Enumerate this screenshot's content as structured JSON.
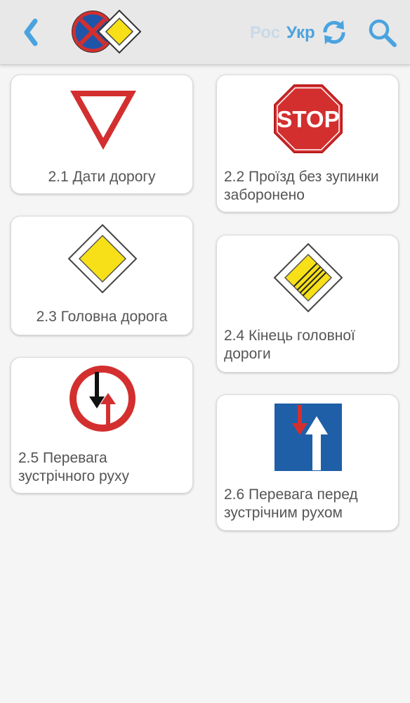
{
  "header": {
    "back_icon": "chevron-left-icon",
    "logo_icon": "road-signs-logo-icon",
    "lang_ru": "Рос",
    "lang_uk": "Укр",
    "swap_icon": "refresh-icon",
    "search_icon": "search-icon",
    "colors": {
      "accent": "#4aa3df",
      "inactive": "#c9d9e8",
      "bar": "#e8e8e8"
    }
  },
  "signs": [
    {
      "label": "2.1 Дати дорогу",
      "icon": "give-way-sign-icon"
    },
    {
      "label": "2.2 Проїзд без зупинки заборонено",
      "icon": "stop-sign-icon",
      "sign_text": "STOP"
    },
    {
      "label": "2.3 Головна дорога",
      "icon": "priority-road-sign-icon"
    },
    {
      "label": "2.4 Кінець головної дороги",
      "icon": "end-priority-road-sign-icon"
    },
    {
      "label": "2.5 Перевага зустрічного руху",
      "icon": "oncoming-priority-sign-icon"
    },
    {
      "label": "2.6 Перевага перед зустрічним рухом",
      "icon": "priority-over-oncoming-sign-icon"
    }
  ]
}
